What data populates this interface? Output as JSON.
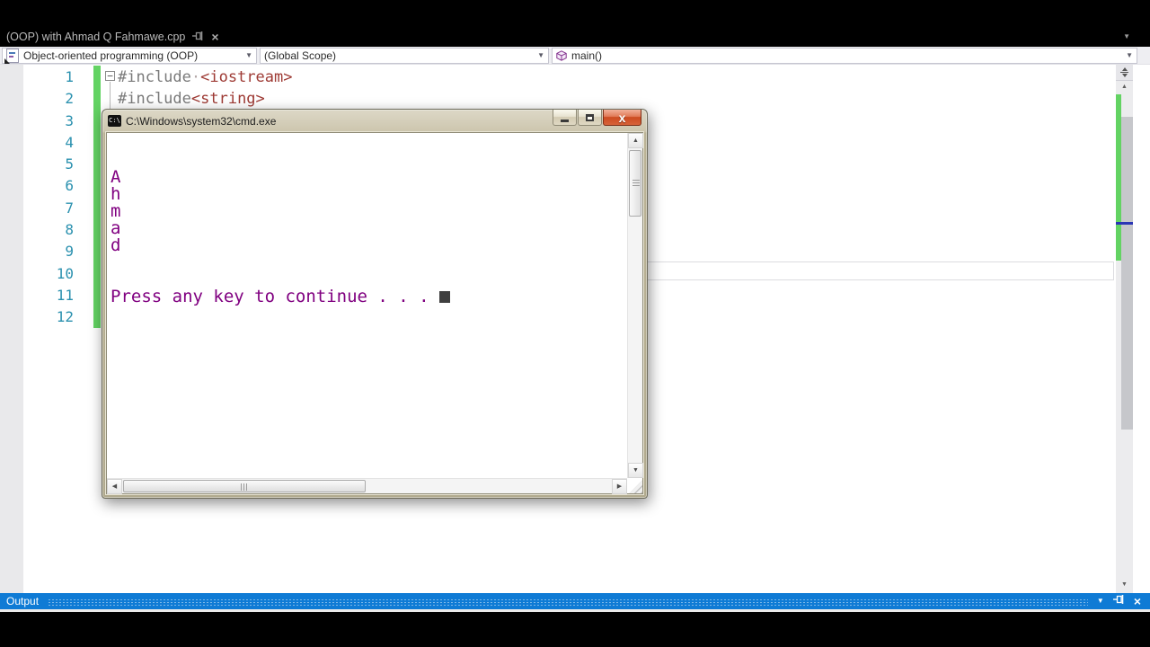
{
  "tab_bar": {
    "tab_title": "(OOP) with Ahmad Q Fahmawe.cpp"
  },
  "nav_bar": {
    "project_dropdown": "Object-oriented programming (OOP)",
    "scope_dropdown": "(Global Scope)",
    "member_dropdown": "main()"
  },
  "editor": {
    "line_numbers": [
      "1",
      "2",
      "3",
      "4",
      "5",
      "6",
      "7",
      "8",
      "9",
      "10",
      "11",
      "12"
    ],
    "fold_glyph": "−",
    "code_lines": [
      {
        "tokens": [
          {
            "text": "#include",
            "cls": "tok-pp"
          },
          {
            "text": "·",
            "cls": "tok-ws"
          },
          {
            "text": "<iostream>",
            "cls": "tok-hdr"
          }
        ]
      },
      {
        "tokens": [
          {
            "text": "#include",
            "cls": "tok-pp"
          },
          {
            "text": "<string>",
            "cls": "tok-hdr"
          }
        ]
      }
    ]
  },
  "cmd_window": {
    "title": "C:\\Windows\\system32\\cmd.exe",
    "icon_text": "C:\\",
    "output_lines": [
      "A",
      "h",
      "m",
      "a",
      "d"
    ],
    "prompt_line": "Press any key to continue . . .",
    "close_glyph": "x"
  },
  "output_panel": {
    "title": "Output"
  },
  "icons": {
    "chevron_down": "▼",
    "scroll_up": "▲",
    "scroll_down": "▼",
    "scroll_left": "◀",
    "scroll_right": "▶",
    "close": "×"
  },
  "colors": {
    "accent_blue": "#0f7bd5",
    "console_text_purple": "#800080",
    "line_number_blue": "#2b91af",
    "change_track_green": "#63d363",
    "preprocessor_gray": "#7a7a7a",
    "header_string_red": "#9e3a34",
    "window_chrome_tan": "#c6bfa6",
    "close_button_red": "#cc4b20"
  }
}
